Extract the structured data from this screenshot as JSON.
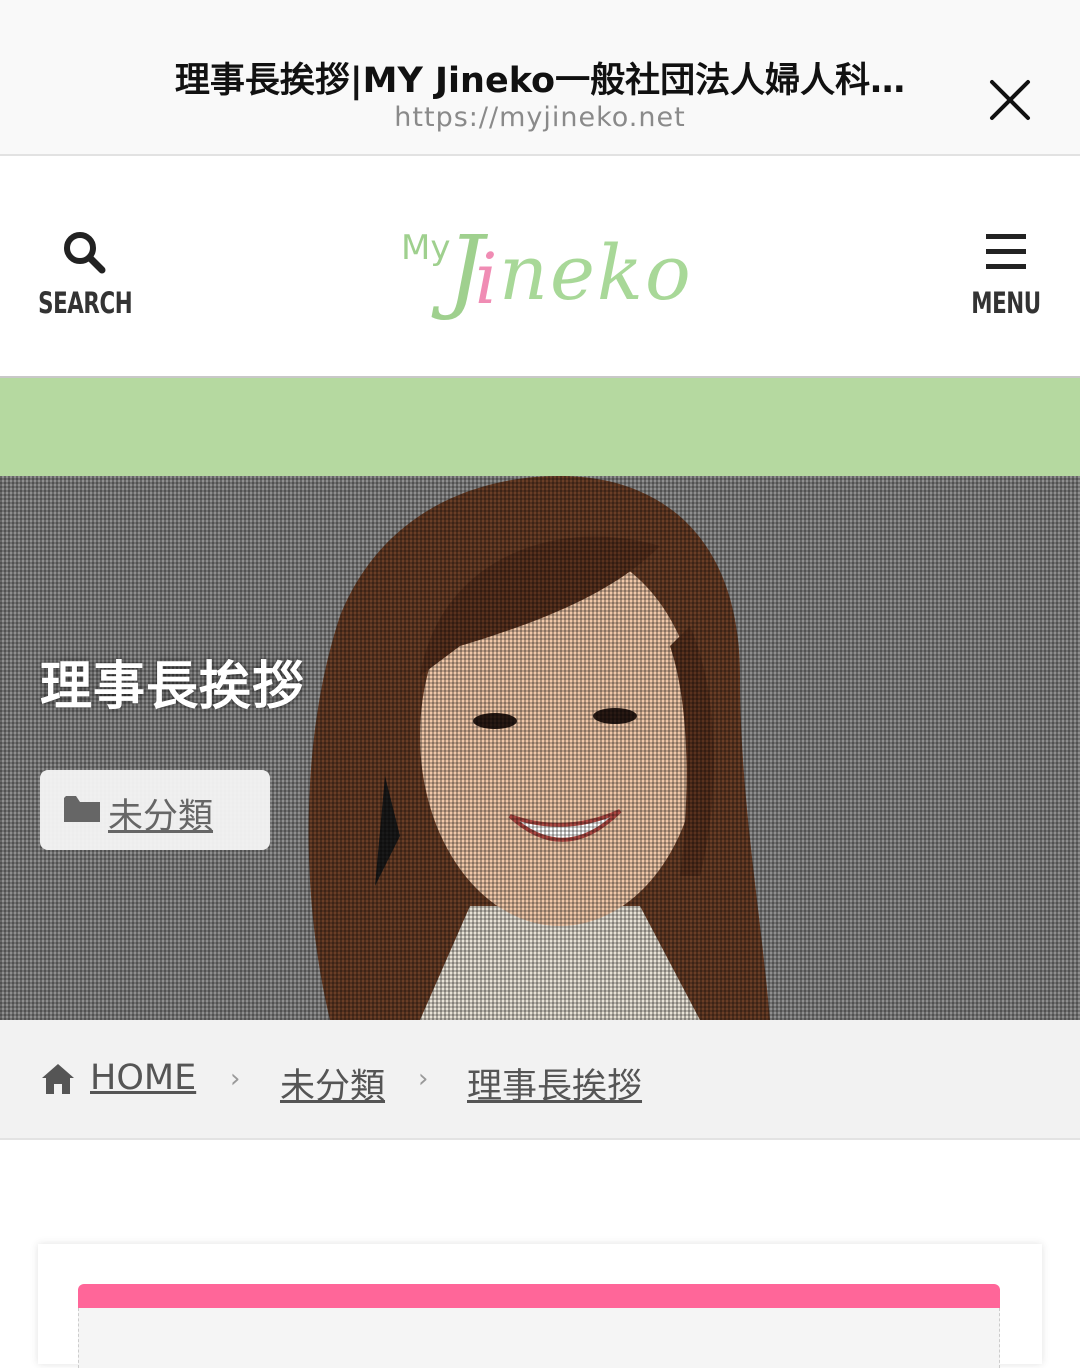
{
  "browser": {
    "title": "理事長挨拶|MY Jineko一般社団法人婦人科…",
    "url": "https://myjineko.net"
  },
  "header": {
    "search_label": "SEARCH",
    "menu_label": "MENU",
    "logo": {
      "my": "My",
      "j": "J",
      "i": "i",
      "rest": "neko"
    }
  },
  "hero": {
    "title": "理事長挨拶",
    "category": "未分類"
  },
  "breadcrumb": {
    "home": "HOME",
    "category": "未分類",
    "current": "理事長挨拶",
    "separator": "›"
  },
  "colors": {
    "accent_green": "#b5d9a0",
    "accent_pink": "#ff6699"
  }
}
